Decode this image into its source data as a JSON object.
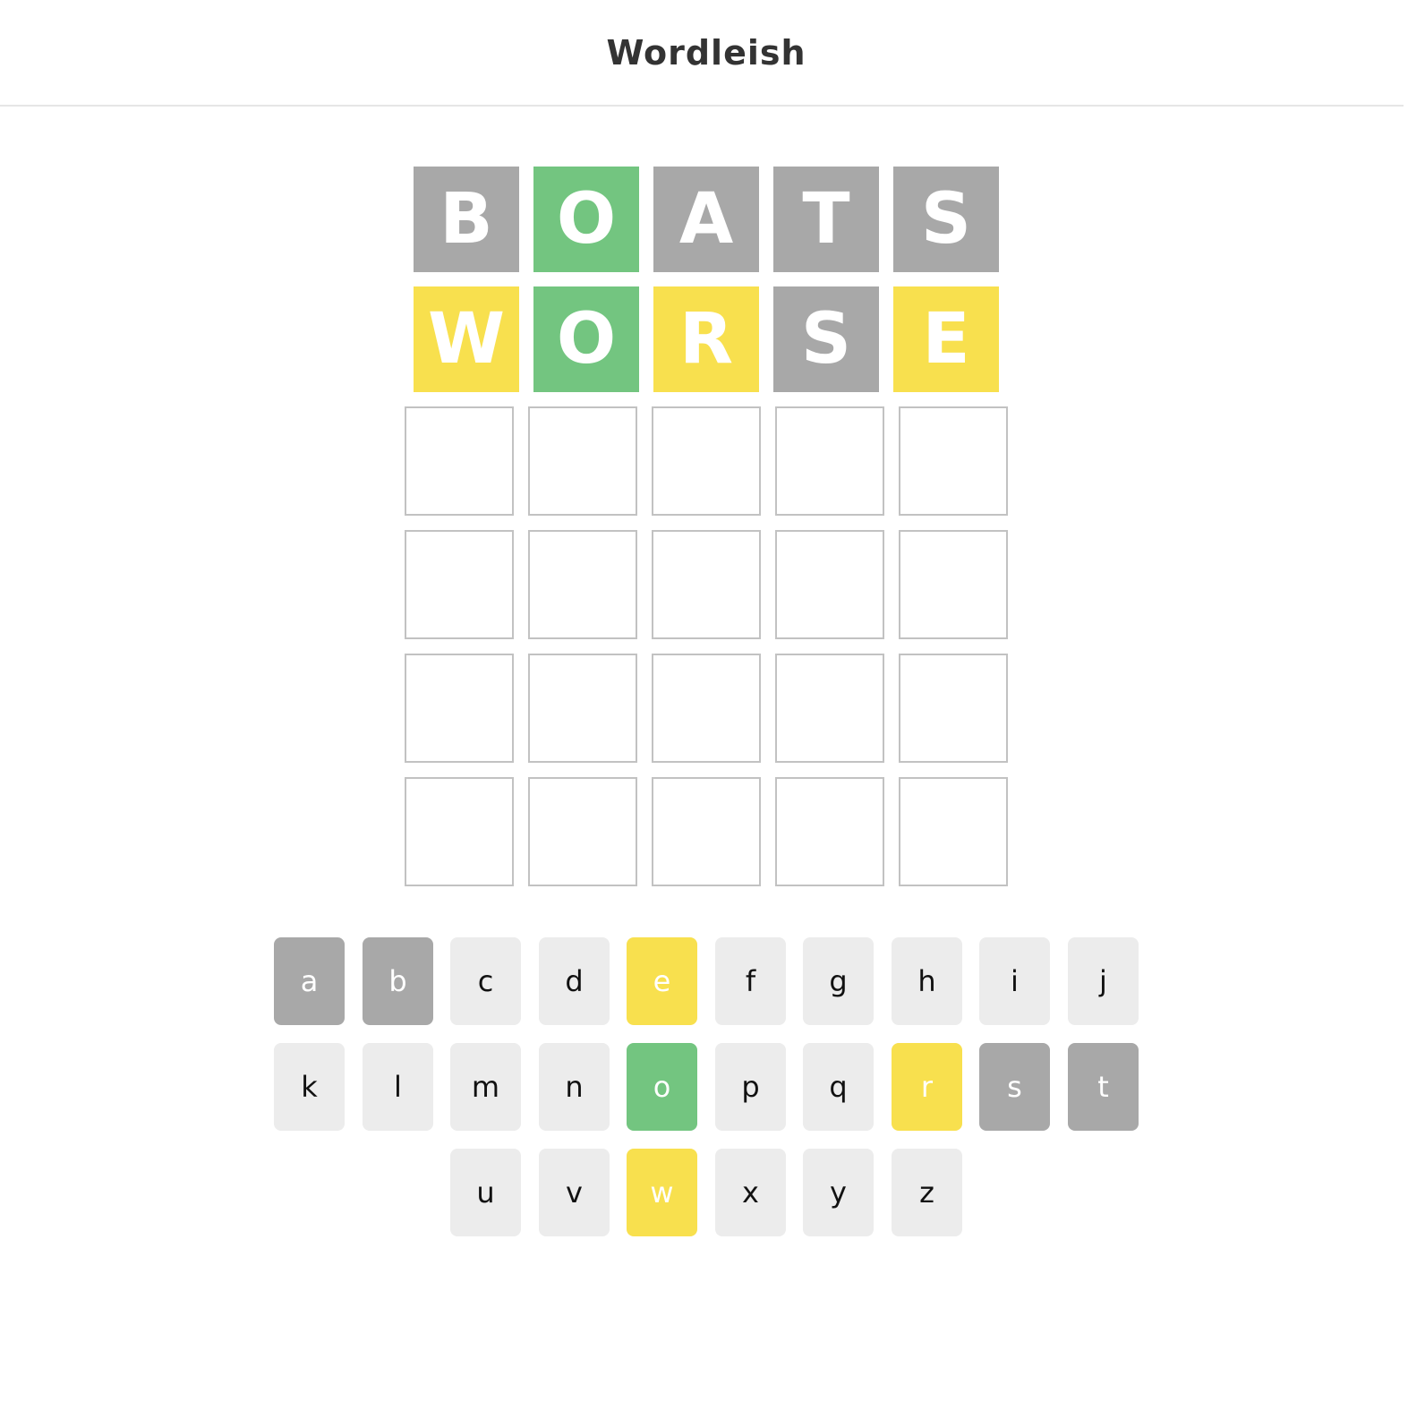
{
  "header": {
    "title": "Wordleish"
  },
  "colors": {
    "absent": "#a8a8a8",
    "correct": "#73c580",
    "present": "#f8e04e",
    "unused_key": "#ececec",
    "empty_border": "#c2c2c2"
  },
  "board": {
    "rows": [
      {
        "letters": [
          "B",
          "O",
          "A",
          "T",
          "S"
        ],
        "states": [
          "absent",
          "correct",
          "absent",
          "absent",
          "absent"
        ]
      },
      {
        "letters": [
          "W",
          "O",
          "R",
          "S",
          "E"
        ],
        "states": [
          "present",
          "correct",
          "present",
          "absent",
          "present"
        ]
      },
      {
        "letters": [
          "",
          "",
          "",
          "",
          ""
        ],
        "states": [
          "empty",
          "empty",
          "empty",
          "empty",
          "empty"
        ]
      },
      {
        "letters": [
          "",
          "",
          "",
          "",
          ""
        ],
        "states": [
          "empty",
          "empty",
          "empty",
          "empty",
          "empty"
        ]
      },
      {
        "letters": [
          "",
          "",
          "",
          "",
          ""
        ],
        "states": [
          "empty",
          "empty",
          "empty",
          "empty",
          "empty"
        ]
      },
      {
        "letters": [
          "",
          "",
          "",
          "",
          ""
        ],
        "states": [
          "empty",
          "empty",
          "empty",
          "empty",
          "empty"
        ]
      }
    ]
  },
  "keyboard": {
    "rows": [
      {
        "keys": [
          {
            "label": "a",
            "state": "absent"
          },
          {
            "label": "b",
            "state": "absent"
          },
          {
            "label": "c",
            "state": "unused"
          },
          {
            "label": "d",
            "state": "unused"
          },
          {
            "label": "e",
            "state": "present"
          },
          {
            "label": "f",
            "state": "unused"
          },
          {
            "label": "g",
            "state": "unused"
          },
          {
            "label": "h",
            "state": "unused"
          },
          {
            "label": "i",
            "state": "unused"
          },
          {
            "label": "j",
            "state": "unused"
          }
        ]
      },
      {
        "keys": [
          {
            "label": "k",
            "state": "unused"
          },
          {
            "label": "l",
            "state": "unused"
          },
          {
            "label": "m",
            "state": "unused"
          },
          {
            "label": "n",
            "state": "unused"
          },
          {
            "label": "o",
            "state": "correct"
          },
          {
            "label": "p",
            "state": "unused"
          },
          {
            "label": "q",
            "state": "unused"
          },
          {
            "label": "r",
            "state": "present"
          },
          {
            "label": "s",
            "state": "absent"
          },
          {
            "label": "t",
            "state": "absent"
          }
        ]
      },
      {
        "keys": [
          {
            "label": "u",
            "state": "unused"
          },
          {
            "label": "v",
            "state": "unused"
          },
          {
            "label": "w",
            "state": "present"
          },
          {
            "label": "x",
            "state": "unused"
          },
          {
            "label": "y",
            "state": "unused"
          },
          {
            "label": "z",
            "state": "unused"
          }
        ]
      }
    ]
  }
}
